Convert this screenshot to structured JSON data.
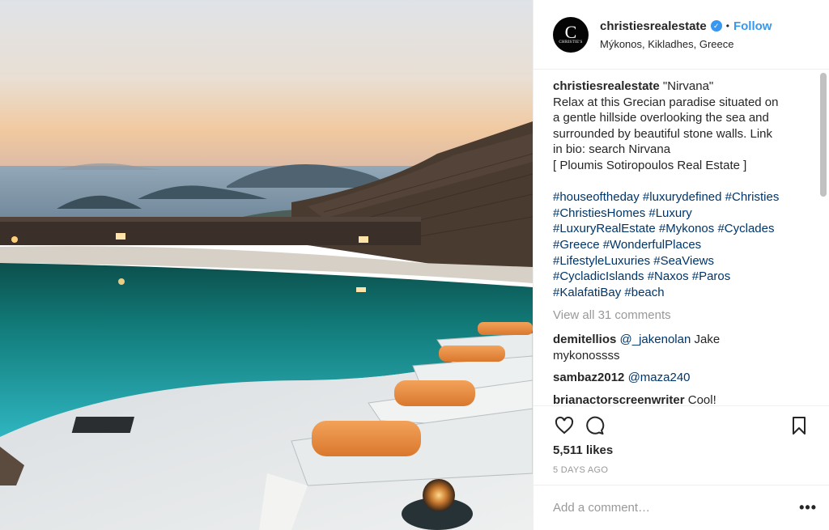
{
  "post": {
    "username": "christiesrealestate",
    "verified_icon": "verified-badge-icon",
    "separator": "•",
    "follow_label": "Follow",
    "location": "Mýkonos, Kikladhes, Greece",
    "avatar": {
      "letter": "C",
      "text": "CHRISTIE'S"
    }
  },
  "caption": {
    "username": "christiesrealestate",
    "lines": [
      "\"Nirvana\"",
      "Relax at this Grecian paradise situated on",
      "a gentle hillside overlooking the sea and",
      "surrounded by beautiful stone walls. Link",
      "in bio: search Nirvana",
      "[ Ploumis Sotiropoulos Real Estate ]"
    ],
    "hashtag_lines": [
      "#houseoftheday #luxurydefined #Christies",
      "#ChristiesHomes #Luxury",
      "#LuxuryRealEstate #Mykonos #Cyclades",
      "#Greece #WonderfulPlaces",
      "#LifestyleLuxuries #SeaViews",
      "#CycladicIslands #Naxos #Paros",
      "#KalafatiBay #beach"
    ]
  },
  "view_all_comments": "View all 31 comments",
  "comments": [
    {
      "user": "demitellios",
      "mention": "@_jakenolan",
      "text": " Jake",
      "text2": "mykonossss"
    },
    {
      "user": "sambaz2012",
      "mention": "@maza240",
      "text": ""
    },
    {
      "user": "brianactorscreenwriter",
      "mention": "",
      "text": "Cool!"
    }
  ],
  "actions": {
    "like_icon": "heart-icon",
    "comment_icon": "comment-bubble-icon",
    "save_icon": "bookmark-icon",
    "likes": "5,511 likes",
    "date": "5 DAYS AGO"
  },
  "add_comment": {
    "placeholder": "Add a comment…",
    "more_label": "•••"
  },
  "colors": {
    "accent": "#3897f0",
    "link": "#003569",
    "muted": "#999999"
  }
}
